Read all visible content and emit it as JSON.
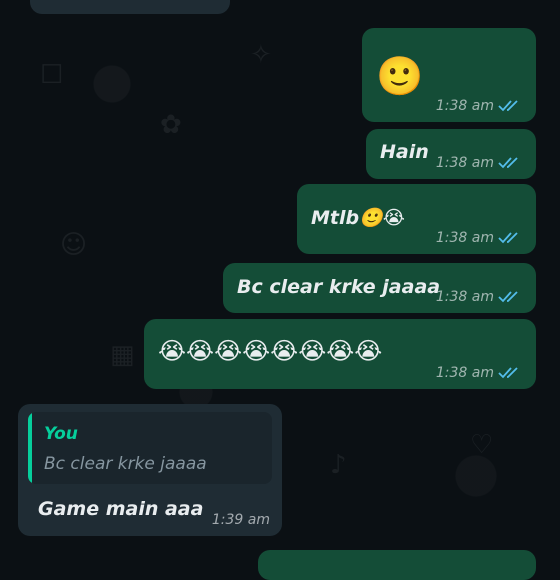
{
  "messages": [
    {
      "type": "outgoing",
      "text": "🙂",
      "time": "1:38 am",
      "status": "read"
    },
    {
      "type": "outgoing",
      "text": "Hain",
      "time": "1:38 am",
      "status": "read"
    },
    {
      "type": "outgoing",
      "text": "Mtlb🙂😭",
      "time": "1:38 am",
      "status": "read"
    },
    {
      "type": "outgoing",
      "text": "Bc clear krke jaaaa",
      "time": "1:38 am",
      "status": "read"
    },
    {
      "type": "outgoing",
      "text": "😭😭😭😭😭😭😭😭",
      "time": "1:38 am",
      "status": "read"
    },
    {
      "type": "incoming",
      "reply": {
        "author": "You",
        "text": "Bc clear krke jaaaa"
      },
      "text": "Game main aaa",
      "time": "1:39 am"
    }
  ],
  "colors": {
    "outgoing_bubble": "#144d37",
    "incoming_bubble": "#1f2c34",
    "read_ticks": "#53bdeb",
    "reply_accent": "#06cf9c",
    "background": "#0b1014"
  },
  "icons": {
    "read_receipt": "double-check-icon"
  }
}
